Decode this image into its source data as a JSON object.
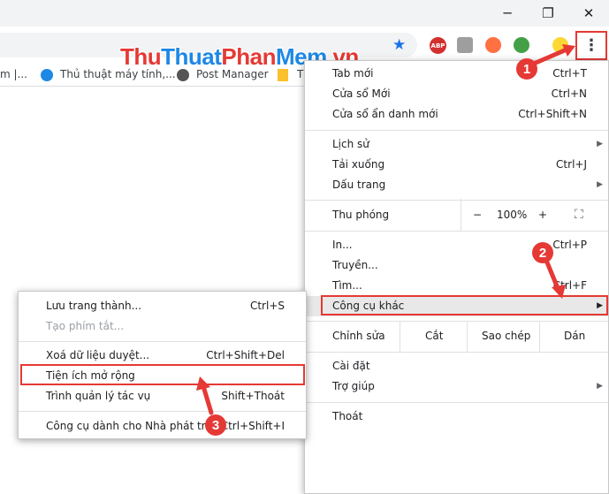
{
  "window": {
    "minimize": "─",
    "restore": "❐",
    "close": "✕"
  },
  "toolbar": {
    "star": "★",
    "ext_abp": "ABP",
    "menu_dots": "⋮"
  },
  "bookmarks": [
    {
      "label": "m |..."
    },
    {
      "label": "Thủ thuật máy tính,..."
    },
    {
      "label": "Post Manager"
    },
    {
      "label": "T"
    }
  ],
  "watermark": {
    "part1": "Thu",
    "part2": "Thuat",
    "part3": "Phan",
    "part4": "Mem",
    "part5": ".vn",
    "colors": [
      "#e53935",
      "#1e88e5",
      "#e53935",
      "#1e88e5",
      "#e53935"
    ]
  },
  "main_menu": {
    "new_tab": {
      "label": "Tab mới",
      "shortcut": "Ctrl+T"
    },
    "new_window": {
      "label": "Cửa sổ Mới",
      "shortcut": "Ctrl+N"
    },
    "incognito": {
      "label": "Cửa sổ ẩn danh mới",
      "shortcut": "Ctrl+Shift+N"
    },
    "history": {
      "label": "Lịch sử"
    },
    "downloads": {
      "label": "Tải xuống",
      "shortcut": "Ctrl+J"
    },
    "bookmarks": {
      "label": "Dấu trang"
    },
    "zoom": {
      "label": "Thu phóng",
      "minus": "−",
      "value": "100%",
      "plus": "+",
      "fullscreen": "⛶"
    },
    "print": {
      "label": "In...",
      "shortcut": "Ctrl+P"
    },
    "cast": {
      "label": "Truyền..."
    },
    "find": {
      "label": "Tìm...",
      "shortcut": "Ctrl+F"
    },
    "more_tools": {
      "label": "Công cụ khác"
    },
    "edit": {
      "label": "Chỉnh sửa",
      "cut": "Cắt",
      "copy": "Sao chép",
      "paste": "Dán"
    },
    "settings": {
      "label": "Cài đặt"
    },
    "help": {
      "label": "Trợ giúp"
    },
    "exit": {
      "label": "Thoát"
    }
  },
  "sub_menu": {
    "save_page": {
      "label": "Lưu trang thành...",
      "shortcut": "Ctrl+S"
    },
    "create_shortcut": {
      "label": "Tạo phím tắt..."
    },
    "clear_data": {
      "label": "Xoá dữ liệu duyệt...",
      "shortcut": "Ctrl+Shift+Del"
    },
    "extensions": {
      "label": "Tiện ích mở rộng"
    },
    "task_manager": {
      "label": "Trình quản lý tác vụ",
      "shortcut": "Shift+Thoát"
    },
    "dev_tools": {
      "label": "Công cụ dành cho Nhà phát triển",
      "shortcut": "Ctrl+Shift+I"
    }
  },
  "badges": {
    "one": "1",
    "two": "2",
    "three": "3"
  },
  "arrow_glyph": "▶",
  "accent": "#e53935"
}
